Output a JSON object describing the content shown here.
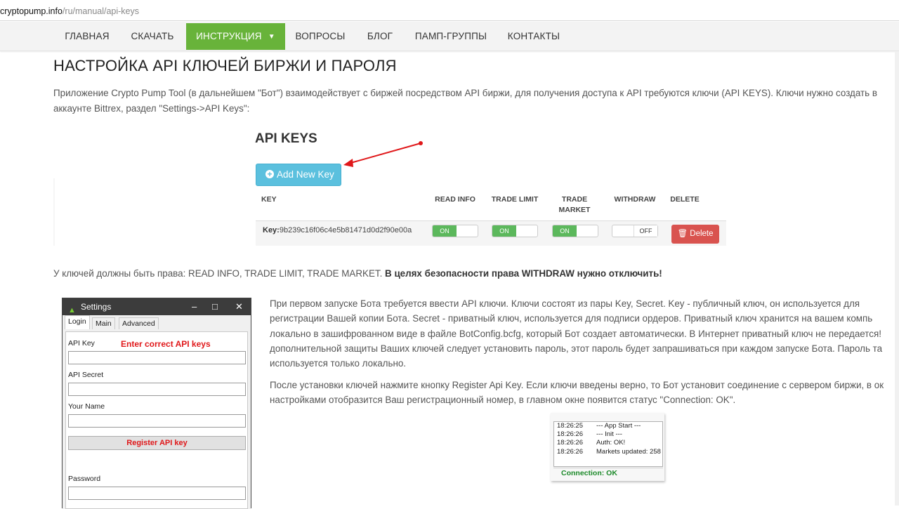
{
  "browser": {
    "url_host": "cryptopump.info",
    "url_path": "/ru/manual/api-keys"
  },
  "nav": {
    "items": [
      "ГЛАВНАЯ",
      "СКАЧАТЬ",
      "ИНСТРУКЦИЯ",
      "ВОПРОСЫ",
      "БЛОГ",
      "ПАМП-ГРУППЫ",
      "КОНТАКТЫ"
    ],
    "active_index": 2,
    "active_color": "#68b33a"
  },
  "page": {
    "title": "НАСТРОЙКА API КЛЮЧЕЙ БИРЖИ И ПАРОЛЯ",
    "intro_line1": "Приложение Crypto Pump Tool (в дальнейшем \"Бот\") взаимодействует с биржей посредством API биржи, для получения доступа к API требуются ключи (API KEYS). Ключи нужно создать в",
    "intro_line2": "аккаунте Bittrex, раздел \"Settings->API Keys\":",
    "rights_text": "У ключей должны быть права: READ INFO, TRADE LIMIT, TRADE MARKET.",
    "rights_bold": "В целях безопасности права WITHDRAW нужно отключить!",
    "para3": [
      "При первом запуске Бота требуется ввести API ключи. Ключи состоят из пары Key, Secret. Key - публичный ключ, он используется для",
      "регистрации Вашей копии Бота. Secret - приватный ключ, используется для подписи ордеров. Приватный ключ хранится на вашем компь",
      "локально в зашифрованном виде в файле BotConfig.bcfg, который Бот создает автоматически. В Интернет приватный ключ не передается!",
      "дополнительной защиты Ваших ключей следует установить пароль, этот пароль будет запрашиваться при каждом запуске Бота. Пароль та",
      "используется только локально."
    ],
    "para4": [
      "После установки ключей нажмите кнопку Register Api Key. Если ключи введены верно, то Бот установит соединение с сервером биржи, в ок",
      "настройками отобразится Ваш регистрационный номер, в главном окне появится статус \"Connection: OK\"."
    ]
  },
  "api_keys": {
    "title": "API KEYS",
    "add_button": "Add New Key",
    "columns": [
      "KEY",
      "READ INFO",
      "TRADE LIMIT",
      "TRADE MARKET",
      "WITHDRAW",
      "DELETE"
    ],
    "key_label": "Key:",
    "key_value": "9b239c16f06c4e5b81471d0d2f90e00a",
    "toggles": [
      {
        "name": "READ INFO",
        "state": "ON"
      },
      {
        "name": "TRADE LIMIT",
        "state": "ON"
      },
      {
        "name": "TRADE MARKET",
        "state": "ON"
      },
      {
        "name": "WITHDRAW",
        "state": "OFF"
      }
    ],
    "delete_button": "Delete",
    "button_color": "#5bc0de",
    "on_color": "#5cb85c",
    "delete_color": "#d9534f",
    "arrow_color": "#e0181a"
  },
  "settings_window": {
    "title": "Settings",
    "tabs": [
      "Login",
      "Main",
      "Advanced"
    ],
    "selected_tab": "Login",
    "warning": "Enter correct API keys",
    "fields": [
      "API Key",
      "API Secret",
      "Your Name",
      "Password"
    ],
    "register_button": "Register API key"
  },
  "log_window": {
    "rows": [
      {
        "time": "18:26:25",
        "text": "--- App Start ---"
      },
      {
        "time": "18:26:26",
        "text": "--- Init ---"
      },
      {
        "time": "18:26:26",
        "text": "Auth: OK!"
      },
      {
        "time": "18:26:26",
        "text": "Markets updated: 258"
      }
    ],
    "status": "Connection: OK"
  }
}
